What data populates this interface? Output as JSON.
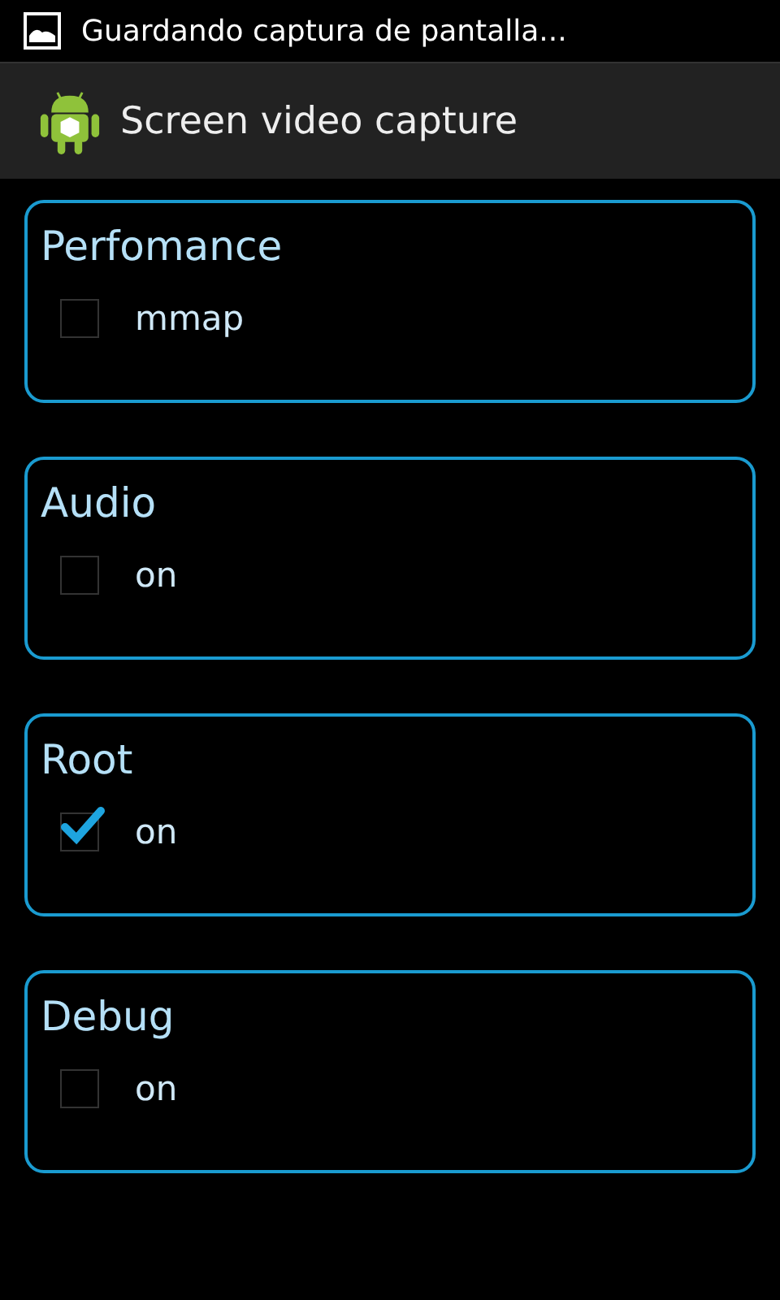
{
  "status_bar": {
    "notification": "Guardando captura de pantalla..."
  },
  "action_bar": {
    "title": "Screen video capture"
  },
  "sections": [
    {
      "title": "Perfomance",
      "option": {
        "label": "mmap",
        "checked": false
      }
    },
    {
      "title": "Audio",
      "option": {
        "label": "on",
        "checked": false
      }
    },
    {
      "title": "Root",
      "option": {
        "label": "on",
        "checked": true
      }
    },
    {
      "title": "Debug",
      "option": {
        "label": "on",
        "checked": false
      }
    }
  ]
}
